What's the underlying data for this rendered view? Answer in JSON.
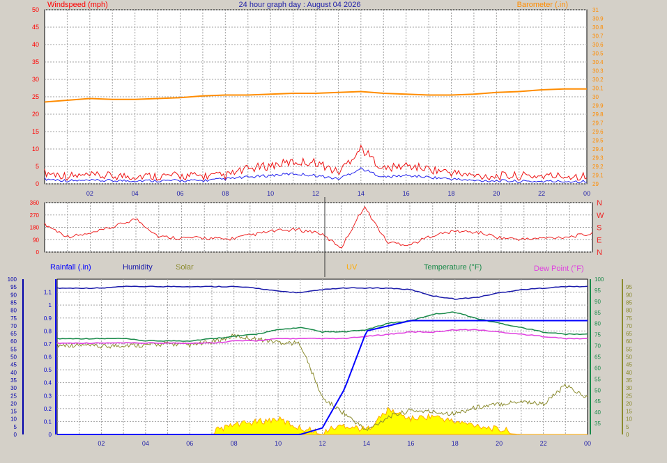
{
  "colors": {
    "wind": "#ff0000",
    "gust": "#ee1111",
    "avgwind": "#2222ee",
    "baro": "#ff8c00",
    "dir": "#ee2222",
    "rain": "#0000ff",
    "hum": "#1a1aaa",
    "solar": "#8b8b2e",
    "uvfill": "#ffff00",
    "uvline": "#ffaa00",
    "temp": "#1a8a4a",
    "dew": "#e040e0",
    "grid": "#a0a0a0",
    "bg": "#d4d0c8",
    "plot": "#ffffff"
  },
  "chart_data": [
    {
      "type": "line",
      "title": "24 hour graph day : August 04 2026",
      "left_label": "Windspeed (mph)",
      "right_label": "Barometer (.in)",
      "xticks": [
        "02",
        "04",
        "06",
        "08",
        "10",
        "12",
        "14",
        "16",
        "18",
        "20",
        "22",
        "00"
      ],
      "ylim_left": [
        0,
        50
      ],
      "yticks_left": [
        "0",
        "5",
        "10",
        "15",
        "20",
        "25",
        "30",
        "35",
        "40",
        "45",
        "50"
      ],
      "ylim_right": [
        29.0,
        31.0
      ],
      "yticks_right": [
        "29",
        "29.1",
        "29.2",
        "29.3",
        "29.4",
        "29.5",
        "29.6",
        "29.7",
        "29.8",
        "29.9",
        "30",
        "30.1",
        "30.2",
        "30.3",
        "30.4",
        "30.5",
        "30.6",
        "30.7",
        "30.8",
        "30.9",
        "31"
      ],
      "x_hours": [
        0,
        1,
        2,
        3,
        4,
        5,
        6,
        7,
        8,
        9,
        10,
        11,
        12,
        13,
        14,
        15,
        16,
        17,
        18,
        19,
        20,
        21,
        22,
        23,
        24
      ],
      "series": [
        {
          "values_gust": [
            2,
            1,
            1,
            1,
            1,
            1,
            1,
            1,
            1,
            3,
            4,
            5,
            5,
            2,
            9,
            3,
            4,
            3,
            2,
            1,
            1,
            1,
            1,
            1,
            1
          ]
        },
        {
          "values_avg": [
            1,
            0.5,
            0.5,
            0.5,
            0.5,
            0.5,
            0.5,
            0.5,
            1,
            1.5,
            2,
            2.5,
            2,
            1,
            4,
            1.5,
            2,
            1.5,
            1,
            0.5,
            0.5,
            0.3,
            0.3,
            0.3,
            0.3
          ]
        },
        {
          "values_baro": [
            29.94,
            29.96,
            29.98,
            29.97,
            29.97,
            29.98,
            29.99,
            30.01,
            30.02,
            30.02,
            30.03,
            30.04,
            30.04,
            30.05,
            30.06,
            30.04,
            30.03,
            30.02,
            30.02,
            30.03,
            30.05,
            30.06,
            30.08,
            30.09,
            30.09
          ]
        }
      ]
    },
    {
      "type": "line",
      "name": "wind direction",
      "xticks": [],
      "ylim": [
        0,
        360
      ],
      "yticks_left": [
        "0",
        "90",
        "180",
        "270",
        "360"
      ],
      "yticks_right": [
        "N",
        "E",
        "S",
        "W",
        "N"
      ],
      "x_hours": [
        0,
        1,
        2,
        3,
        4,
        5,
        6,
        7,
        8,
        9,
        10,
        11,
        12,
        13,
        14,
        15,
        16,
        17,
        18,
        19,
        20,
        21,
        22,
        23,
        24
      ],
      "values": [
        190,
        100,
        120,
        170,
        230,
        100,
        90,
        90,
        80,
        110,
        140,
        150,
        130,
        20,
        320,
        60,
        40,
        110,
        140,
        130,
        90,
        80,
        90,
        100,
        120
      ]
    },
    {
      "type": "line",
      "header_labels": {
        "rain": "Rainfall (.in)",
        "hum": "Humidity",
        "solar": "Solar",
        "uv": "UV",
        "temp": "Temperature (°F)",
        "dew": "Dew Point (°F)"
      },
      "xticks": [
        "02",
        "04",
        "06",
        "08",
        "10",
        "12",
        "14",
        "16",
        "18",
        "20",
        "22",
        "00"
      ],
      "ylim_left_pct": [
        0,
        100
      ],
      "yticks_left_pct": [
        "0",
        "5",
        "10",
        "15",
        "20",
        "25",
        "30",
        "35",
        "40",
        "45",
        "50",
        "55",
        "60",
        "65",
        "70",
        "75",
        "80",
        "85",
        "90",
        "95",
        "100"
      ],
      "ylim_left_rain": [
        0,
        1.2
      ],
      "yticks_left_rain": [
        "0",
        "0.1",
        "0.2",
        "0.3",
        "0.4",
        "0.5",
        "0.6",
        "0.7",
        "0.8",
        "0.9",
        "1",
        "1.1"
      ],
      "ylim_right_temp": [
        30,
        100
      ],
      "yticks_right_temp": [
        "35",
        "40",
        "45",
        "50",
        "55",
        "60",
        "65",
        "70",
        "75",
        "80",
        "85",
        "90",
        "95",
        "100"
      ],
      "ylim_right_solar": [
        0,
        100
      ],
      "yticks_right_solar": [
        "0",
        "5",
        "10",
        "15",
        "20",
        "25",
        "30",
        "35",
        "40",
        "45",
        "50",
        "55",
        "60",
        "65",
        "70",
        "75",
        "80",
        "85",
        "90",
        "95"
      ],
      "x_hours": [
        0,
        1,
        2,
        3,
        4,
        5,
        6,
        7,
        8,
        9,
        10,
        11,
        12,
        13,
        14,
        15,
        16,
        17,
        18,
        19,
        20,
        21,
        22,
        23,
        24
      ],
      "rain": [
        0,
        0,
        0,
        0,
        0,
        0,
        0,
        0,
        0,
        0,
        0,
        0,
        0.05,
        0.35,
        0.8,
        0.84,
        0.88,
        0.88,
        0.88,
        0.88,
        0.88,
        0.88,
        0.88,
        0.88,
        0.88
      ],
      "humidity": [
        94,
        94,
        94,
        95,
        95,
        95,
        95,
        95,
        95,
        94,
        92,
        91,
        93,
        94,
        94,
        94,
        93,
        89,
        87,
        88,
        91,
        93,
        94,
        95,
        95
      ],
      "temperature": [
        73,
        73,
        73,
        73,
        72,
        72,
        72,
        73,
        74,
        75,
        77,
        78,
        76,
        76,
        77,
        80,
        81,
        84,
        85,
        82,
        80,
        78,
        76,
        75,
        75
      ],
      "dewpoint": [
        71,
        71,
        71,
        71,
        71,
        71,
        71,
        71,
        72,
        72,
        73,
        73,
        73,
        73,
        74,
        75,
        76,
        76,
        77,
        77,
        76,
        75,
        74,
        73,
        73
      ],
      "solar": [
        56,
        56,
        55,
        56,
        56,
        57,
        56,
        58,
        62,
        60,
        58,
        57,
        22,
        12,
        1,
        10,
        14,
        13,
        12,
        16,
        18,
        20,
        18,
        30,
        22
      ],
      "uv": [
        0,
        0,
        0,
        0,
        0,
        0,
        0,
        0,
        4,
        6,
        8,
        2,
        0,
        4,
        1,
        14,
        8,
        10,
        6,
        4,
        1,
        0,
        0,
        0,
        0
      ]
    }
  ]
}
